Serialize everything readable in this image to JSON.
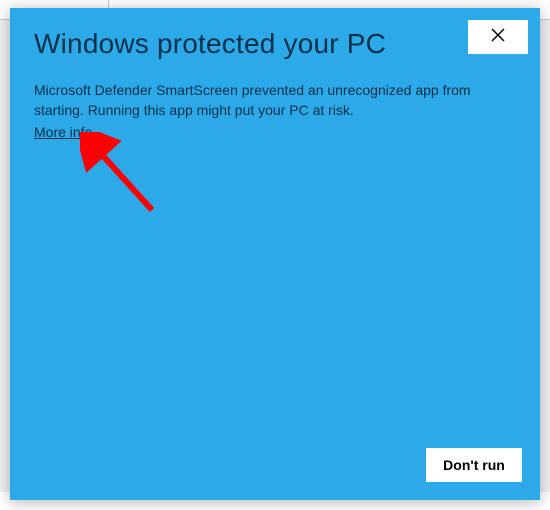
{
  "dialog": {
    "title": "Windows protected your PC",
    "body": "Microsoft Defender SmartScreen prevented an unrecognized app from starting. Running this app might put your PC at risk.",
    "more_info_label": "More info",
    "dont_run_label": "Don't run"
  },
  "colors": {
    "dialog_bg": "#2ca9e9",
    "text": "#083049",
    "annotation_arrow": "#ff0000"
  }
}
